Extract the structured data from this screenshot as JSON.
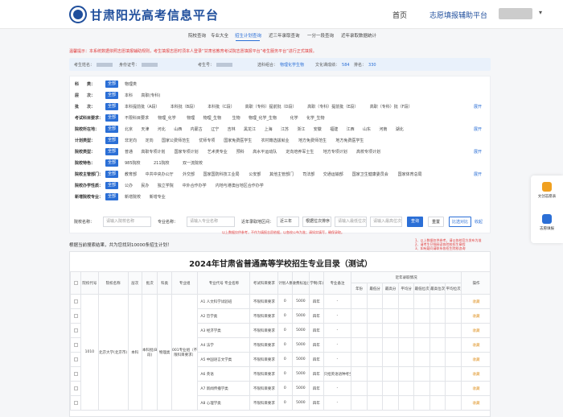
{
  "header": {
    "site_title": "甘肃阳光高考信息平台",
    "nav": [
      {
        "label": "首页"
      },
      {
        "label": "志愿填报辅助平台"
      }
    ]
  },
  "tabs": [
    {
      "label": "院校查询"
    },
    {
      "label": "专业大全"
    },
    {
      "label": "招生计划查询",
      "active": true
    },
    {
      "label": "近三年录取查询"
    },
    {
      "label": "一分一段查询"
    },
    {
      "label": "近年录取数据统计"
    }
  ],
  "notice": "温馨提示：本系统数据依照志愿填报辅助规则，考生填报志愿时须本人登录“甘肃省教育考试院志愿填报平台”考生服务平台”进行正式填报。",
  "candidate": {
    "fields": [
      {
        "label": "考生姓名："
      },
      {
        "label": "身份证号："
      },
      {
        "label": "考生号："
      },
      {
        "label": "选科组合：",
        "value": "物理化学生物"
      },
      {
        "label": "文化课成绩：",
        "value": "584"
      },
      {
        "label": "排名：",
        "value": "330"
      }
    ]
  },
  "filters": {
    "all_label": "全部",
    "more_label": "展开",
    "rows": [
      {
        "label": "科　　类：",
        "options": [
          "物理类"
        ]
      },
      {
        "label": "层　　次：",
        "options": [
          "本科",
          "高职(专科)"
        ]
      },
      {
        "label": "批　　次：",
        "options": [
          "本科提前批（A段）",
          "本科批（B段）",
          "本科批（C段）",
          "高职（专科）提前批（D段）",
          "高职（专科）提前批（E段）",
          "高职（专科）批（F段）"
        ],
        "has_more": true
      },
      {
        "label": "考试科目要求：",
        "options": [
          "不限科目要求",
          "物理_化学",
          "物理",
          "物理_生物",
          "生物",
          "物理_化学_生物",
          "化学",
          "化学_生物"
        ]
      },
      {
        "label": "院校所在地：",
        "options": [
          "北京",
          "天津",
          "河北",
          "山西",
          "内蒙古",
          "辽宁",
          "吉林",
          "黑龙江",
          "上海",
          "江苏",
          "浙江",
          "安徽",
          "福建",
          "江西",
          "山东",
          "河南",
          "湖北"
        ],
        "has_more": true
      },
      {
        "label": "计划类型：",
        "options": [
          "非定向",
          "定向",
          "国家公费师范生",
          "优师专项",
          "国家免费医学生",
          "农村籍选拔就业",
          "地方免费师范生",
          "地方免费医学生"
        ]
      },
      {
        "label": "院校类型：",
        "options": [
          "普通",
          "高职专项计划",
          "国家专项计划",
          "艺术类专业",
          "预科",
          "高水平运动队",
          "定向培养军士生",
          "地方专项计划",
          "高校专项计划"
        ],
        "has_more": true
      },
      {
        "label": "院校特色：",
        "options": [
          "985院校",
          "211院校",
          "双一流院校"
        ]
      },
      {
        "label": "院校主管部门：",
        "options": [
          "教育部",
          "中共中央办公厅",
          "外交部",
          "国家国防科技工业局",
          "公安部",
          "其他主管部门",
          "司法部",
          "交通运输部",
          "国家卫生健康委员会",
          "国家体育总局"
        ],
        "has_more": true
      },
      {
        "label": "院校办学性质：",
        "options": [
          "公办",
          "民办",
          "独立学院",
          "中外合作办学",
          "内地与港澳台地区合作办学"
        ]
      },
      {
        "label": "新增院校专业：",
        "options": [
          "新增院校",
          "新增专业"
        ]
      }
    ]
  },
  "search": {
    "school_label": "院校名称：",
    "school_placeholder": "请输入院校名称",
    "major_label": "专业名称：",
    "major_placeholder": "请输入专业名称",
    "years_label": "近年录取地区间：",
    "year_value": "近三年",
    "score_select": "根据位次排序",
    "from_placeholder": "请输入最低位次",
    "to_placeholder": "请输入最高位次",
    "query_label": "查询",
    "reset_label": "重置",
    "compare_label": "比选对比",
    "collapse_label": "收起",
    "note": "以上数据仅供参考，不作为填报志愿依据，以各校公布为准；请如实填写，确保录取。"
  },
  "result_note": "根据当前搜索结果，共为您找到10000条招生计划！",
  "side_notes": [
    "1、以上数据仅供参考，请以各校官方发布为准",
    "2、请考生仔细阅读各院校招生章程",
    "3、如有疑问请联系各招生院校咨询"
  ],
  "table": {
    "title": "2024年甘肃省普通高等学校招生专业目录（测试）",
    "headers": [
      "",
      "院校代号",
      "院校名称",
      "层次",
      "批次",
      "科类",
      "专业组",
      "专业代号 专业名称",
      "考试科目要求",
      "计划人数",
      "收费标准(元/年)",
      "学制(年)",
      "专业备注",
      "近年录取情况",
      "操作"
    ],
    "sub_headers": [
      "年份",
      "最低分",
      "最高分",
      "平均分",
      "最低位次",
      "最高位次",
      "平均位次"
    ],
    "school": {
      "code": "1010",
      "name": "北京大学(北京市)",
      "level": "本科",
      "batch": "本科批(B段)",
      "track": "物理类",
      "group": "001专业组（不限科目要求）"
    },
    "rows": [
      {
        "major": "A1  人文科学试验班",
        "req": "不限科目要求",
        "plan": "0",
        "fee": "5000",
        "years": "四年",
        "note": "-",
        "action": "收藏"
      },
      {
        "major": "A2  哲学类",
        "req": "不限科目要求",
        "plan": "0",
        "fee": "5000",
        "years": "四年",
        "note": "-",
        "action": "收藏"
      },
      {
        "major": "A3  经济学类",
        "req": "不限科目要求",
        "plan": "0",
        "fee": "5000",
        "years": "四年",
        "note": "-",
        "action": "收藏"
      },
      {
        "major": "A4  法学",
        "req": "不限科目要求",
        "plan": "0",
        "fee": "5000",
        "years": "四年",
        "note": "-",
        "action": "收藏"
      },
      {
        "major": "A5  中国语言文学类",
        "req": "不限科目要求",
        "plan": "0",
        "fee": "5000",
        "years": "四年",
        "note": "-",
        "action": "收藏"
      },
      {
        "major": "A6  英语",
        "req": "不限科目要求",
        "plan": "0",
        "fee": "5000",
        "years": "四年",
        "note": "只招英语语种考生",
        "action": "收藏"
      },
      {
        "major": "A7  新闻传播学类",
        "req": "不限科目要求",
        "plan": "0",
        "fee": "5000",
        "years": "四年",
        "note": "-",
        "action": "收藏"
      },
      {
        "major": "A8  心理学类",
        "req": "不限科目要求",
        "plan": "0",
        "fee": "5000",
        "years": "四年",
        "note": "-",
        "action": "收藏"
      }
    ]
  },
  "float_panel": [
    {
      "label": "文创志愿表",
      "color": "#f0a020",
      "icon": "star-icon"
    },
    {
      "label": "志愿填报",
      "color": "#2b6fd6",
      "icon": "form-icon"
    }
  ],
  "colors": {
    "primary": "#2b6fd6",
    "brand": "#1f4e9c",
    "warning": "#e03a3a"
  }
}
